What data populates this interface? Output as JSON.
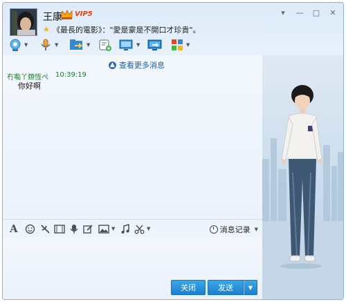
{
  "header": {
    "name": "王康",
    "vip_label": "VIP5",
    "signature": "《最長的電影》：\"愛是霥是不開口才珍貴\"。"
  },
  "window_controls": {
    "menu": "▾",
    "minimize": "—",
    "maximize": "□",
    "close": "✕"
  },
  "toolbar": {
    "items": [
      {
        "icon": "video-call-icon",
        "dropdown": true
      },
      {
        "icon": "voice-call-icon",
        "dropdown": true
      },
      {
        "icon": "send-file-icon",
        "dropdown": true
      },
      {
        "icon": "create-group-icon",
        "dropdown": false
      },
      {
        "icon": "remote-desktop-icon",
        "dropdown": true
      },
      {
        "icon": "share-screen-icon",
        "dropdown": false
      },
      {
        "icon": "apps-icon",
        "dropdown": true
      }
    ]
  },
  "chat": {
    "more_messages": "查看更多消息",
    "messages": [
      {
        "sender": "冇嚸丫爒恆ぺ",
        "time": "10:39:19",
        "text": "你好啊"
      }
    ]
  },
  "input_toolbar": {
    "icons": [
      "font-icon",
      "emoji-icon",
      "shake-icon",
      "video-clip-icon",
      "voice-message-icon",
      "edit-image-icon",
      "image-icon",
      "music-icon",
      "screenshot-icon"
    ],
    "history_label": "消息记录"
  },
  "buttons": {
    "close": "关闭",
    "send": "发送",
    "send_arrow": "▼"
  },
  "colors": {
    "accent": "#1c7fcc",
    "sender_green": "#1a7d28",
    "link_blue": "#1b5fa8"
  }
}
